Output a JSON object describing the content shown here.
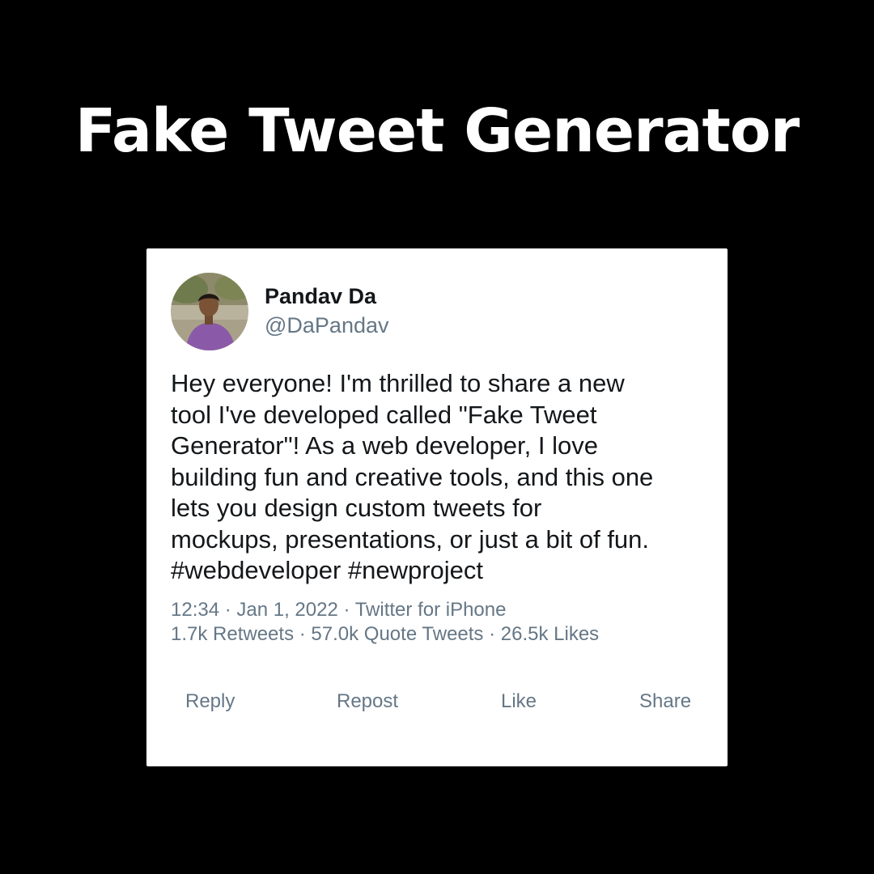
{
  "banner": {
    "title": "Fake Tweet Generator"
  },
  "tweet": {
    "avatar_icon": "user-photo-avatar",
    "display_name": "Pandav Da",
    "handle": "@DaPandav",
    "text": "Hey everyone! I'm thrilled to share a new\ntool I've developed called \"Fake Tweet\nGenerator\"! As a web developer, I love\nbuilding fun and creative tools, and this one\nlets you design custom tweets for\nmockups, presentations, or just a bit of fun.\n#webdeveloper #newproject",
    "timestamp_line": "12:34 · Jan 1, 2022 · Twitter for iPhone",
    "stats_line": "1.7k Retweets · 57.0k Quote Tweets · 26.5k Likes"
  },
  "actions": {
    "reply": "Reply",
    "repost": "Repost",
    "like": "Like",
    "share": "Share"
  },
  "colors": {
    "page_background": "#000000",
    "card_background": "#ffffff",
    "primary_text": "#14171a",
    "secondary_text": "#657786"
  }
}
